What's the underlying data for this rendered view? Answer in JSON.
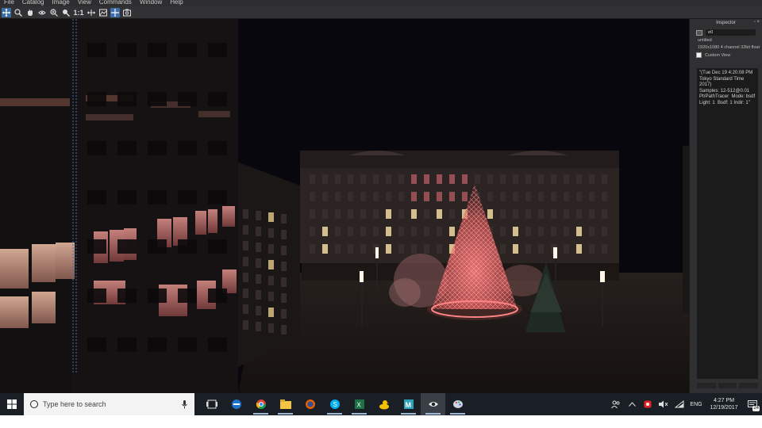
{
  "menubar": {
    "items": [
      "File",
      "Catalog",
      "Image",
      "View",
      "Commands",
      "Window",
      "Help"
    ]
  },
  "toolbar": {
    "ratio_label": "1:1"
  },
  "inspector": {
    "title": "Inspector",
    "name_value": "e0",
    "doc_name": "untitled",
    "image_info": "1920x1080 4 channel 32bit float",
    "custom_view_label": "Custom View",
    "notes": "\"(Tue Dec 19 4:20:08 PM Tokyo Standard Time 2017)\nSamples: 12-512@0.01\nPtrPathTracer  Mode: bsdf  Light: 1  Bsdf: 1 Indir: 1\""
  },
  "taskbar": {
    "search_placeholder": "Type here to search",
    "apps": [
      "task-view",
      "edge",
      "chrome",
      "file-explorer",
      "firefox",
      "skype",
      "excel",
      "duck-app",
      "m-app",
      "eye-app",
      "paint-app"
    ],
    "language": "ENG",
    "time": "4:27 PM",
    "date": "12/19/2017",
    "notification_count": "24"
  },
  "colors": {
    "tree_glow": "#ff6a6a",
    "accent_blue": "#3c6ea8",
    "taskbar": "#1a1f25"
  }
}
